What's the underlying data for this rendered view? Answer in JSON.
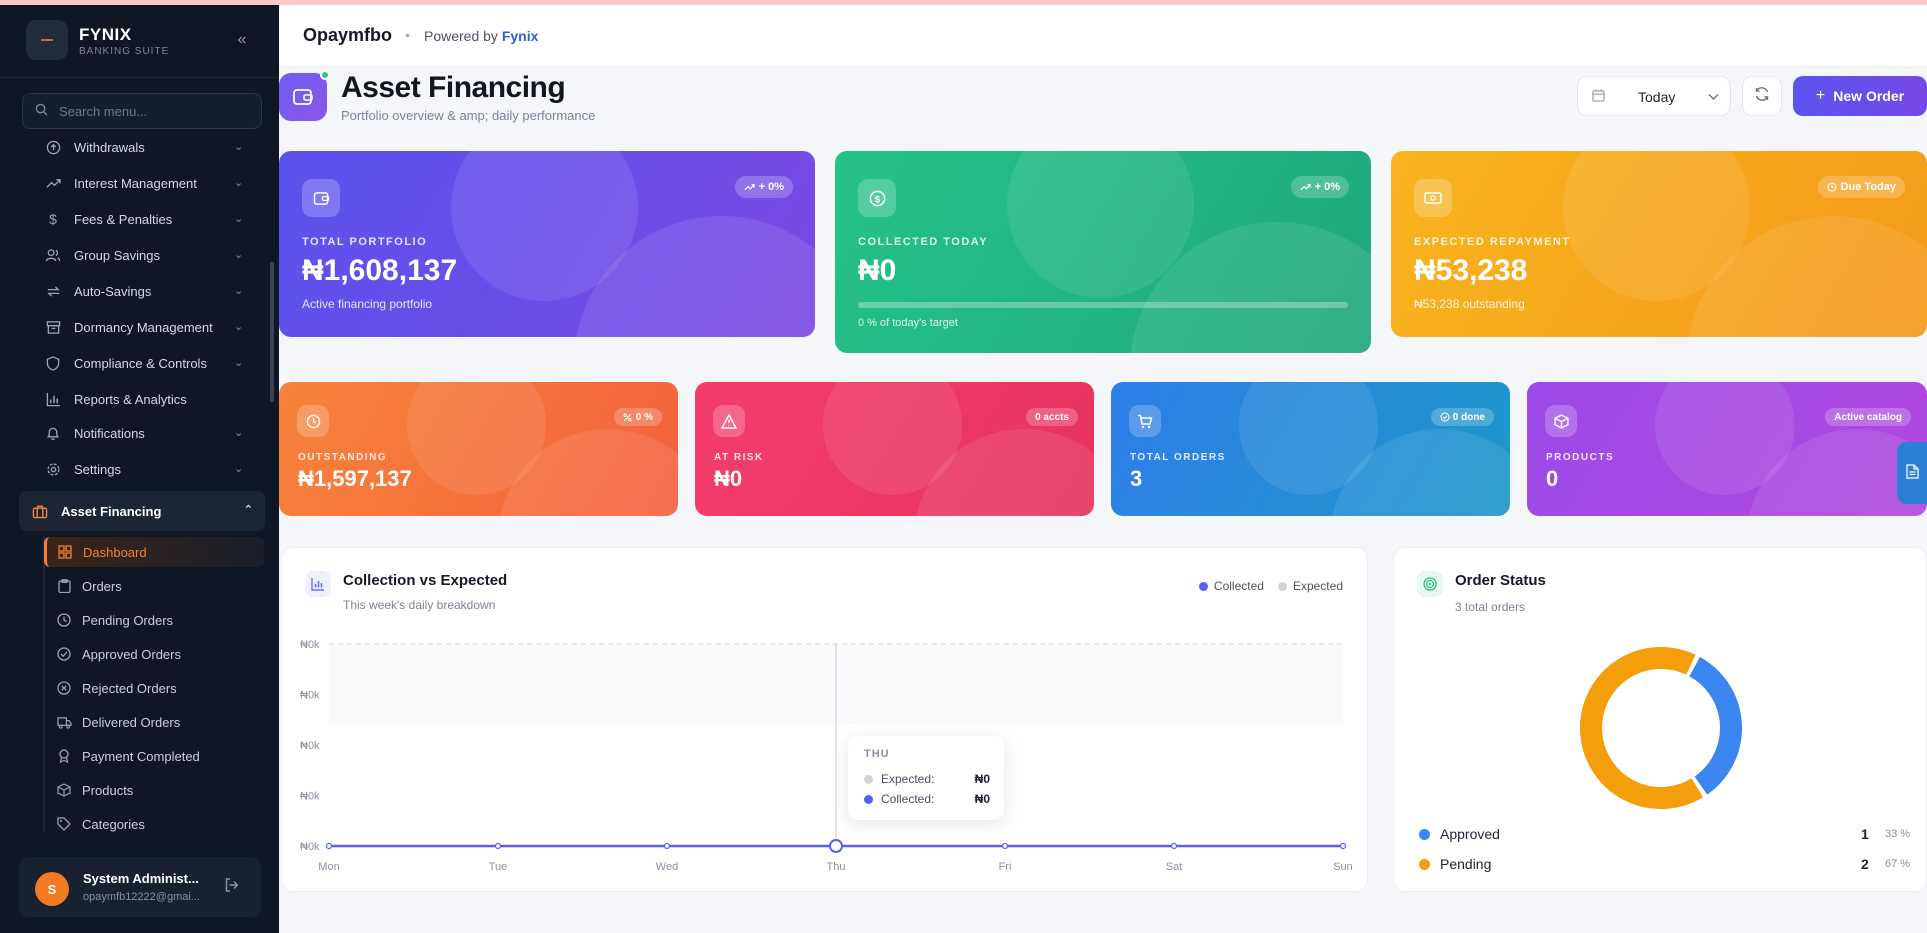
{
  "brand": {
    "name": "FYNIX",
    "subtitle": "BANKING SUITE"
  },
  "search": {
    "placeholder": "Search menu..."
  },
  "menu": [
    {
      "label": "Withdrawals",
      "icon": "arrow-up-circle-icon"
    },
    {
      "label": "Interest Management",
      "icon": "trending-up-icon"
    },
    {
      "label": "Fees & Penalties",
      "icon": "dollar-icon"
    },
    {
      "label": "Group Savings",
      "icon": "users-icon"
    },
    {
      "label": "Auto-Savings",
      "icon": "repeat-icon"
    },
    {
      "label": "Dormancy Management",
      "icon": "archive-icon"
    },
    {
      "label": "Compliance & Controls",
      "icon": "shield-icon"
    },
    {
      "label": "Reports & Analytics",
      "icon": "bar-chart-icon"
    },
    {
      "label": "Notifications",
      "icon": "bell-icon"
    },
    {
      "label": "Settings",
      "icon": "gear-icon"
    }
  ],
  "active_section": {
    "label": "Asset Financing",
    "icon": "briefcase-icon"
  },
  "submenu": [
    {
      "label": "Dashboard",
      "icon": "grid-icon"
    },
    {
      "label": "Orders",
      "icon": "clipboard-icon"
    },
    {
      "label": "Pending Orders",
      "icon": "clock-icon"
    },
    {
      "label": "Approved Orders",
      "icon": "check-circle-icon"
    },
    {
      "label": "Rejected Orders",
      "icon": "x-circle-icon"
    },
    {
      "label": "Delivered Orders",
      "icon": "truck-icon"
    },
    {
      "label": "Payment Completed",
      "icon": "badge-icon"
    },
    {
      "label": "Products",
      "icon": "box-icon"
    },
    {
      "label": "Categories",
      "icon": "tag-icon"
    }
  ],
  "user": {
    "initial": "S",
    "name": "System Administ...",
    "email": "opaymfb12222@gmai..."
  },
  "header": {
    "org": "Opaymfbo",
    "separator": "•",
    "powered_prefix": "Powered by",
    "powered_brand": "Fynix"
  },
  "page": {
    "title": "Asset Financing",
    "subtitle": "Portfolio overview & amp; daily performance"
  },
  "toolbar": {
    "date_value": "Today",
    "new_order_label": "New Order"
  },
  "cards_large": [
    {
      "label": "TOTAL PORTFOLIO",
      "value": "₦1,608,137",
      "sub": "Active financing portfolio",
      "badge": "+ 0%",
      "badge_icon": "trend-up-icon",
      "icon": "wallet-icon",
      "color_from": "#5a52ee",
      "color_to": "#7a4ae2"
    },
    {
      "label": "COLLECTED TODAY",
      "value": "₦0",
      "sub": "0 % of today's target",
      "badge": "+ 0%",
      "badge_icon": "trend-up-icon",
      "icon": "coin-icon",
      "color_from": "#26c289",
      "color_to": "#1fa77c",
      "progress": 0
    },
    {
      "label": "EXPECTED REPAYMENT",
      "value": "₦53,238",
      "sub": "₦53,238 outstanding",
      "badge": "Due Today",
      "badge_icon": "clock-icon",
      "icon": "cash-icon",
      "color_from": "#f8b41f",
      "color_to": "#f49a1a"
    }
  ],
  "cards_small": [
    {
      "label": "OUTSTANDING",
      "value": "₦1,597,137",
      "badge": "0 %",
      "badge_icon": "percent-icon",
      "icon": "clock-icon",
      "color_from": "#f7843a",
      "color_to": "#f2613f"
    },
    {
      "label": "AT RISK",
      "value": "₦0",
      "badge": "0 accts",
      "badge_icon": "",
      "icon": "warning-icon",
      "color_from": "#f43d6b",
      "color_to": "#e6335e"
    },
    {
      "label": "TOTAL ORDERS",
      "value": "3",
      "badge": "0 done",
      "badge_icon": "check-icon",
      "icon": "cart-icon",
      "color_from": "#2f7ee8",
      "color_to": "#1c98c9"
    },
    {
      "label": "PRODUCTS",
      "value": "0",
      "badge": "Active catalog",
      "badge_icon": "",
      "icon": "box-icon",
      "color_from": "#9b4ae8",
      "color_to": "#b148e0"
    }
  ],
  "collection_chart": {
    "title": "Collection vs Expected",
    "subtitle": "This week's daily breakdown",
    "legend": [
      {
        "name": "Collected",
        "color": "#5b5ff0"
      },
      {
        "name": "Expected",
        "color": "#cfd3da"
      }
    ],
    "tooltip": {
      "day": "THU",
      "expected_label": "Expected:",
      "expected_value": "₦0",
      "collected_label": "Collected:",
      "collected_value": "₦0"
    }
  },
  "order_status": {
    "title": "Order Status",
    "subtitle": "3 total orders",
    "items": [
      {
        "name": "Approved",
        "count": "1",
        "pct": "33 %",
        "color": "#3b86f0"
      },
      {
        "name": "Pending",
        "count": "2",
        "pct": "67 %",
        "color": "#f59e0b"
      }
    ]
  },
  "chart_data": [
    {
      "type": "line",
      "categories": [
        "Mon",
        "Tue",
        "Wed",
        "Thu",
        "Fri",
        "Sat",
        "Sun"
      ],
      "series": [
        {
          "name": "Collected",
          "values": [
            0,
            0,
            0,
            0,
            0,
            0,
            0
          ]
        },
        {
          "name": "Expected",
          "values": [
            0,
            0,
            0,
            0,
            0,
            0,
            0
          ]
        }
      ],
      "yticks": [
        "₦0k",
        "₦0k",
        "₦0k",
        "₦0k",
        "₦0k"
      ],
      "highlight": "Thu"
    },
    {
      "type": "pie",
      "categories": [
        "Approved",
        "Pending"
      ],
      "values": [
        1,
        2
      ]
    }
  ]
}
